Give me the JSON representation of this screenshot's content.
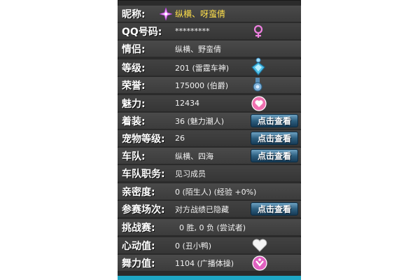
{
  "profile": {
    "nickname": {
      "label": "昵称:",
      "value": "纵横、呀蛮倩",
      "icon": "sparkle-icon"
    },
    "qq": {
      "label": "QQ号码:",
      "value": "*********",
      "icon": "female-symbol-icon"
    },
    "partner": {
      "label": "情侣:",
      "value": "纵横、野蛮倩"
    },
    "level": {
      "label": "等级:",
      "value": "201 (雷霆车神)",
      "icon": "gem-badge-icon"
    },
    "honor": {
      "label": "荣誉:",
      "value": "175000 (伯爵)",
      "icon": "medal-icon"
    },
    "charm": {
      "label": "魅力:",
      "value": "12434",
      "icon": "charm-heart-icon"
    },
    "outfit": {
      "label": "着装:",
      "value": "36 (魅力潮人)",
      "button": "点击查看"
    },
    "pet_level": {
      "label": "宠物等级:",
      "value": "26",
      "button": "点击查看"
    },
    "team": {
      "label": "车队:",
      "value": "纵横、四海",
      "button": "点击查看"
    },
    "team_role": {
      "label": "车队职务:",
      "value": "见习成员"
    },
    "intimacy": {
      "label": "亲密度:",
      "value": "0 (陌生人) (经验 +0%)"
    },
    "race_count": {
      "label": "参赛场次:",
      "value": "对方战绩已隐藏",
      "button": "点击查看"
    },
    "challenge": {
      "label": "挑战赛:",
      "value": "0 胜, 0 负 (尝试者)"
    },
    "heartbeat": {
      "label": "心动值:",
      "value": "0 (丑小鸭)",
      "icon": "white-heart-icon"
    },
    "dance": {
      "label": "舞力值:",
      "value": "1104 (广播体操)",
      "icon": "dance-badge-icon"
    }
  },
  "colors": {
    "panel_bg": "#2b2b2b",
    "row_bg": "#454545",
    "nickname_color": "#ffe04a",
    "button_bg": "#2d5f80",
    "bottom_strip": "#1ea7c4"
  }
}
